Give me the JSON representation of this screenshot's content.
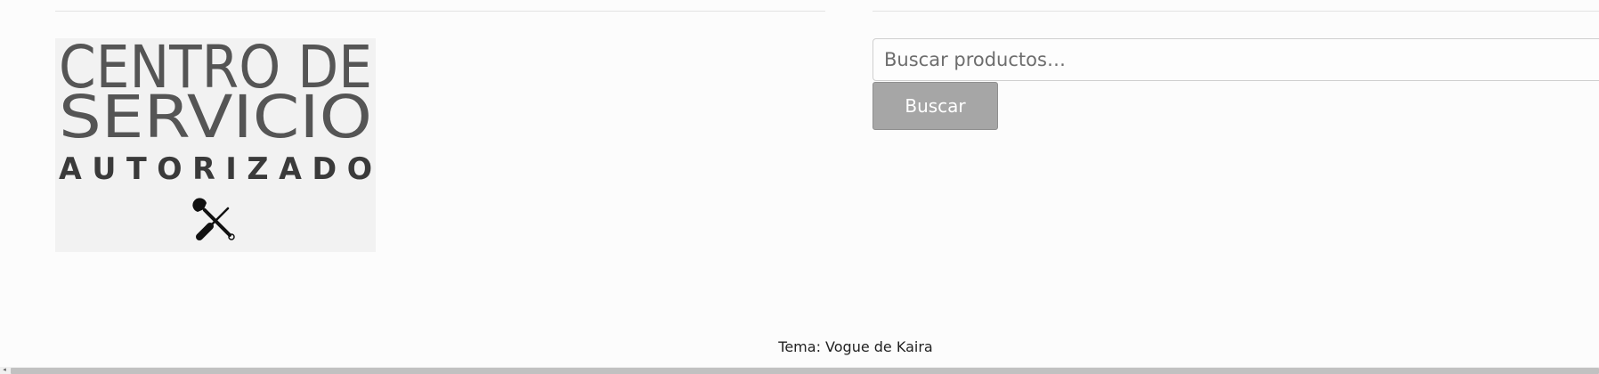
{
  "logo": {
    "line1": "CENTRO DE",
    "line2": "SERVICIO",
    "line3": "A U T O R I Z A D O",
    "icon": "wrench-screwdriver-icon"
  },
  "search": {
    "placeholder": "Buscar productos…",
    "button_label": "Buscar"
  },
  "footer": {
    "credit": "Tema: Vogue de Kaira"
  },
  "scrollbar": {
    "left_arrow": "◂"
  }
}
